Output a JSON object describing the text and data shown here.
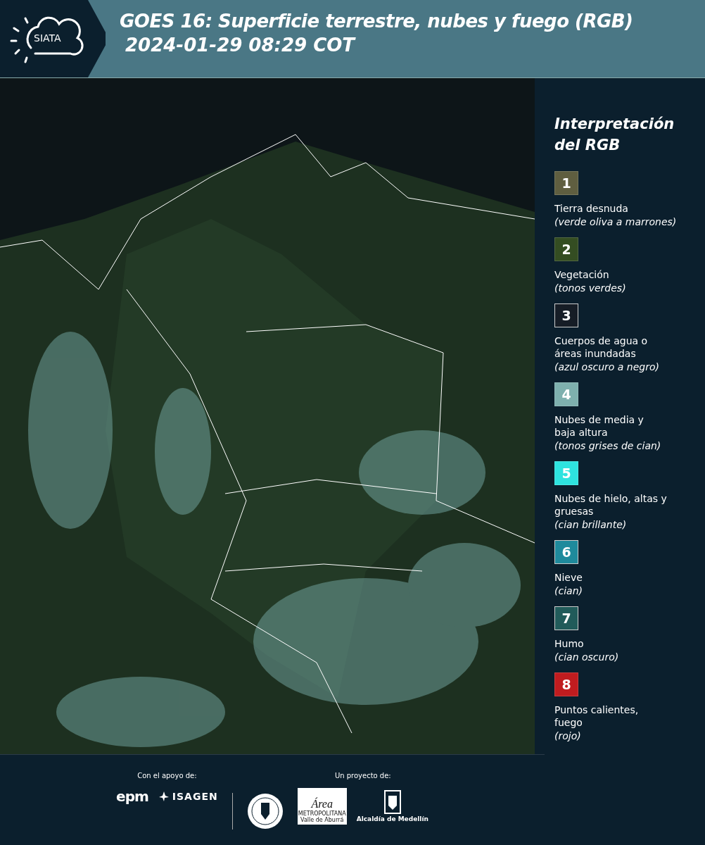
{
  "header": {
    "logo_text": "SIATA",
    "title": "GOES 16: Superficie terrestre, nubes y fuego (RGB)",
    "subtitle": "2024-01-29 08:29 COT"
  },
  "legend": {
    "title": "Interpretación del RGB",
    "items": [
      {
        "number": "1",
        "color": "#5f5e40",
        "label": "Tierra desnuda",
        "note": "(verde oliva a marrones)"
      },
      {
        "number": "2",
        "color": "#344d22",
        "label": "Vegetación",
        "note": "(tonos verdes)"
      },
      {
        "number": "3",
        "color": "#161d26",
        "label": "Cuerpos de agua o áreas inundadas",
        "note": "(azul oscuro a negro)"
      },
      {
        "number": "4",
        "color": "#7eb0ae",
        "label": "Nubes de media y baja altura",
        "note": "(tonos grises de cian)"
      },
      {
        "number": "5",
        "color": "#2ee3df",
        "label": "Nubes de hielo, altas y gruesas",
        "note": "(cian brillante)"
      },
      {
        "number": "6",
        "color": "#1f8a9c",
        "label": "Nieve",
        "note": "(cian)"
      },
      {
        "number": "7",
        "color": "#215b5a",
        "label": "Humo",
        "note": "(cian oscuro)"
      },
      {
        "number": "8",
        "color": "#c01c1f",
        "label": "Puntos calientes, fuego",
        "note": "(rojo)"
      }
    ]
  },
  "footer": {
    "support_label": "Con el apoyo de:",
    "project_label": "Un proyecto de:",
    "epm": "epm",
    "isagen": "ISAGEN",
    "area_title": "Área",
    "area_sub": "METROPOLITANA",
    "area_place": "Valle de Aburrá",
    "alcaldia": "Alcaldía de Medellín"
  }
}
